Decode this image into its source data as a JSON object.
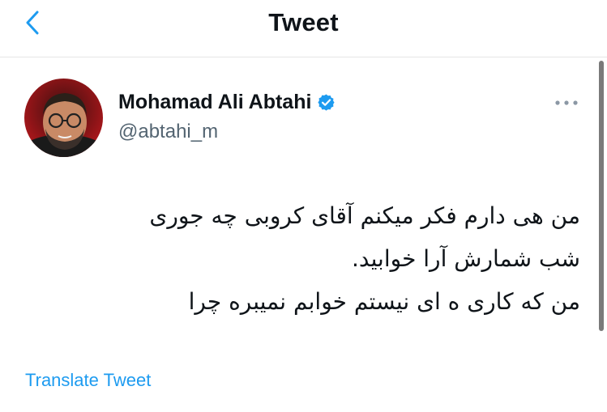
{
  "header": {
    "title": "Tweet",
    "back_icon": "chevron-left-icon",
    "accent_color": "#1d9bf0"
  },
  "author": {
    "display_name": "Mohamad Ali Abtahi",
    "handle": "@abtahi_m",
    "verified": true,
    "verified_icon": "verified-badge-icon"
  },
  "tweet": {
    "lines": [
      "من هی دارم فکر میکنم آقای کروبی چه جوری",
      "شب شمارش آرا خوابید.",
      "من که کاری ه ای نیستم خوابم نمیبره چرا"
    ]
  },
  "actions": {
    "translate_label": "Translate Tweet",
    "more_icon": "more-horizontal-icon"
  }
}
